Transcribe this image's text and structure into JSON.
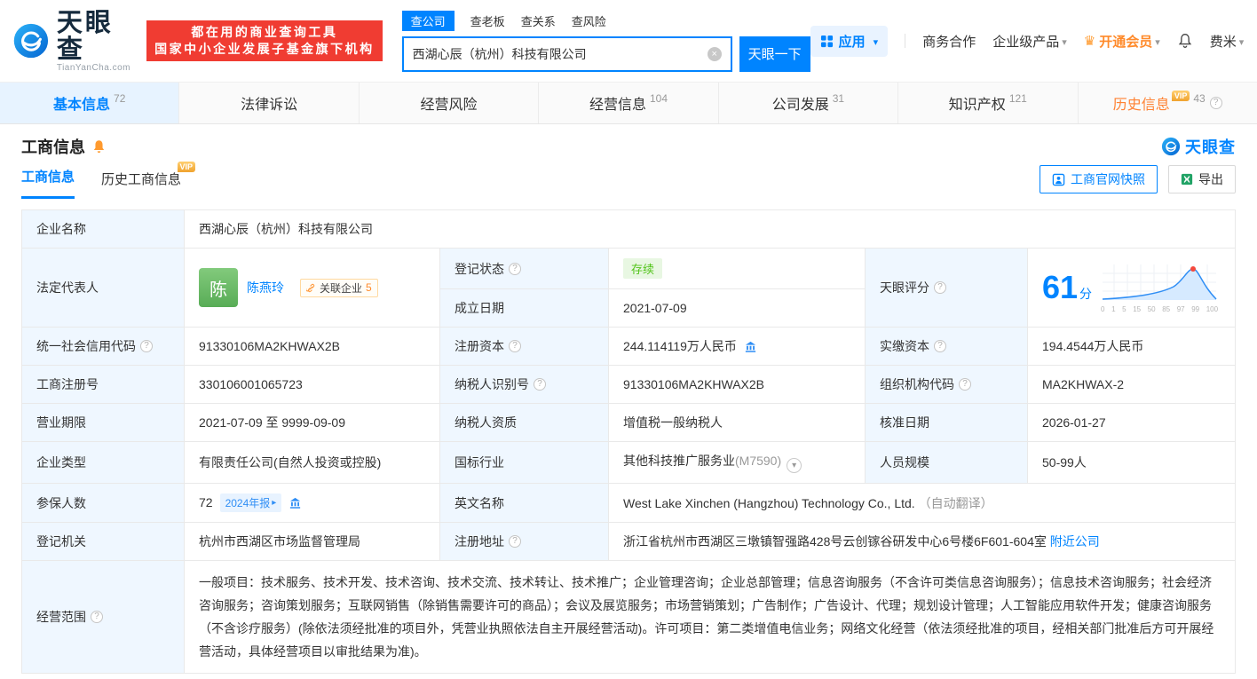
{
  "brand": {
    "name": "天眼查",
    "domain": "TianYanCha.com"
  },
  "banner": {
    "line1": "都在用的商业查询工具",
    "line2": "国家中小企业发展子基金旗下机构"
  },
  "search": {
    "tabs": [
      {
        "label": "查公司"
      },
      {
        "label": "查老板"
      },
      {
        "label": "查关系"
      },
      {
        "label": "查风险"
      }
    ],
    "value": "西湖心辰（杭州）科技有限公司",
    "button_label": "天眼一下"
  },
  "header_nav": {
    "apps": "应用",
    "cooperation": "商务合作",
    "enterprise": "企业级产品",
    "vip": "开通会员",
    "username": "费米"
  },
  "main_tabs": [
    {
      "label": "基本信息",
      "count": "72"
    },
    {
      "label": "法律诉讼",
      "count": ""
    },
    {
      "label": "经营风险",
      "count": ""
    },
    {
      "label": "经营信息",
      "count": "104"
    },
    {
      "label": "公司发展",
      "count": "31"
    },
    {
      "label": "知识产权",
      "count": "121"
    },
    {
      "label": "历史信息",
      "count": "43",
      "badge": "VIP"
    }
  ],
  "section": {
    "title": "工商信息",
    "subtab_current": "工商信息",
    "subtab_history": "历史工商信息",
    "vip_badge": "VIP",
    "snapshot_button": "工商官网快照",
    "export_button": "导出",
    "logo_text": "天眼查"
  },
  "score": {
    "label": "天眼评分",
    "value": "61",
    "unit": "分",
    "axis": [
      "0",
      "1",
      "5",
      "15",
      "50",
      "85",
      "97",
      "99",
      "100"
    ]
  },
  "fields": {
    "company_name": {
      "label": "企业名称",
      "value": "西湖心辰（杭州）科技有限公司"
    },
    "legal_rep": {
      "label": "法定代表人",
      "avatar": "陈",
      "name": "陈燕玲",
      "related_label": "关联企业",
      "related_count": "5"
    },
    "reg_status": {
      "label": "登记状态",
      "value": "存续"
    },
    "establish_date": {
      "label": "成立日期",
      "value": "2021-07-09"
    },
    "credit_code": {
      "label": "统一社会信用代码",
      "value": "91330106MA2KHWAX2B"
    },
    "reg_capital": {
      "label": "注册资本",
      "value": "244.114119万人民币"
    },
    "paid_capital": {
      "label": "实缴资本",
      "value": "194.4544万人民币"
    },
    "reg_number": {
      "label": "工商注册号",
      "value": "330106001065723"
    },
    "taxpayer_id": {
      "label": "纳税人识别号",
      "value": "91330106MA2KHWAX2B"
    },
    "org_code": {
      "label": "组织机构代码",
      "value": "MA2KHWAX-2"
    },
    "business_term": {
      "label": "营业期限",
      "value": "2021-07-09 至 9999-09-09"
    },
    "taxpayer_quality": {
      "label": "纳税人资质",
      "value": "增值税一般纳税人"
    },
    "approval_date": {
      "label": "核准日期",
      "value": "2026-01-27"
    },
    "company_type": {
      "label": "企业类型",
      "value": "有限责任公司(自然人投资或控股)"
    },
    "industry": {
      "label": "国标行业",
      "value": "其他科技推广服务业",
      "code": "(M7590)"
    },
    "staff_size": {
      "label": "人员规模",
      "value": "50-99人"
    },
    "insured_count": {
      "label": "参保人数",
      "value": "72",
      "badge": "2024年报"
    },
    "english_name": {
      "label": "英文名称",
      "value": "West Lake Xinchen (Hangzhou) Technology Co., Ltd.",
      "note": "（自动翻译）"
    },
    "reg_authority": {
      "label": "登记机关",
      "value": "杭州市西湖区市场监督管理局"
    },
    "reg_address": {
      "label": "注册地址",
      "value": "浙江省杭州市西湖区三墩镇智强路428号云创镓谷研发中心6号楼6F601-604室",
      "link": "附近公司"
    },
    "business_scope": {
      "label": "经营范围",
      "value": "一般项目：技术服务、技术开发、技术咨询、技术交流、技术转让、技术推广；企业管理咨询；企业总部管理；信息咨询服务（不含许可类信息咨询服务）；信息技术咨询服务；社会经济咨询服务；咨询策划服务；互联网销售（除销售需要许可的商品）；会议及展览服务；市场营销策划；广告制作；广告设计、代理；规划设计管理；人工智能应用软件开发；健康咨询服务（不含诊疗服务）(除依法须经批准的项目外，凭营业执照依法自主开展经营活动)。许可项目：第二类增值电信业务；网络文化经营（依法须经批准的项目，经相关部门批准后方可开展经营活动，具体经营项目以审批结果为准)。"
    }
  }
}
